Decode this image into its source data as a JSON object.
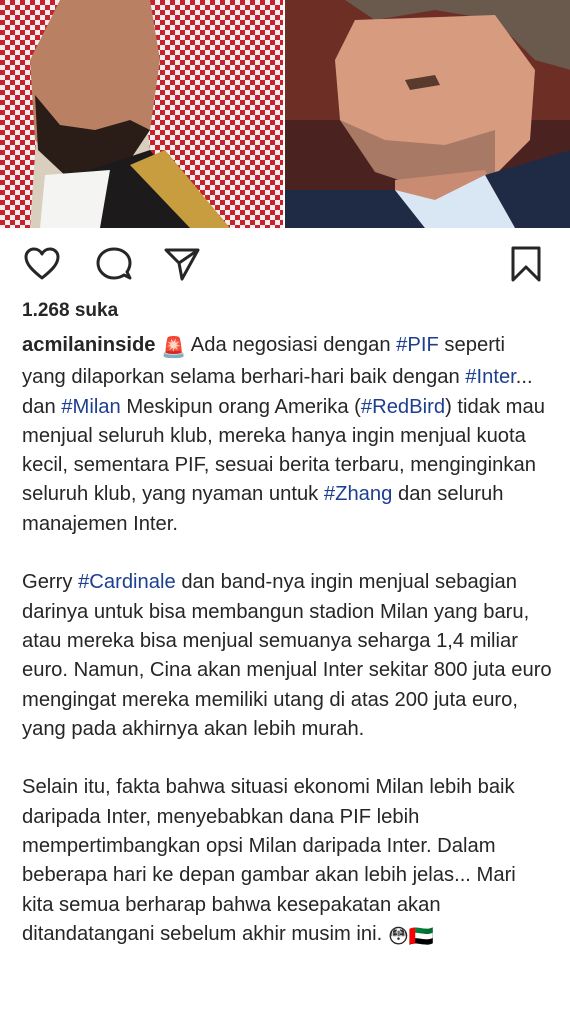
{
  "post": {
    "images": [
      {
        "alt_icon": "person-photo-left"
      },
      {
        "alt_icon": "person-photo-right"
      }
    ],
    "actions": {
      "like_icon": "heart-icon",
      "comment_icon": "comment-icon",
      "share_icon": "send-icon",
      "save_icon": "bookmark-icon"
    },
    "likes_text": "1.268 suka",
    "username": "acmilaninside",
    "caption": {
      "p1": {
        "emoji": "🚨",
        "t1": " Ada negosiasi dengan ",
        "tag1": "#PIF",
        "t2": " seperti yang dilaporkan selama berhari-hari baik dengan ",
        "tag2": "#Inter",
        "t3": "... dan ",
        "tag3": "#Milan",
        "t4": " Meskipun orang Amerika (",
        "tag4": "#RedBird",
        "t5": ") tidak mau menjual seluruh klub, mereka hanya ingin menjual kuota kecil, sementara PIF, sesuai berita terbaru, menginginkan seluruh klub, yang nyaman untuk ",
        "tag5": "#Zhang",
        "t6": " dan seluruh manajemen Inter."
      },
      "p2": {
        "t1": "Gerry ",
        "tag1": "#Cardinale",
        "t2": " dan band-nya ingin menjual sebagian darinya untuk bisa membangun stadion Milan yang baru, atau mereka bisa menjual semuanya seharga 1,4 miliar euro. Namun, Cina akan menjual Inter sekitar 800 juta euro mengingat mereka memiliki utang di atas 200 juta euro, yang pada akhirnya akan lebih murah."
      },
      "p3": {
        "t1": "Selain itu, fakta bahwa situasi ekonomi Milan lebih baik daripada Inter, menyebabkan dana PIF lebih mempertimbangkan opsi Milan daripada Inter. Dalam beberapa hari ke depan gambar akan lebih jelas... Mari kita semua berharap bahwa kesepakatan akan ditandatangani sebelum akhir musim ini. ",
        "emoji1": "😳",
        "emoji2": "🇦🇪"
      }
    },
    "colors": {
      "hashtag": "#1c3f8f",
      "text": "#262626"
    }
  }
}
